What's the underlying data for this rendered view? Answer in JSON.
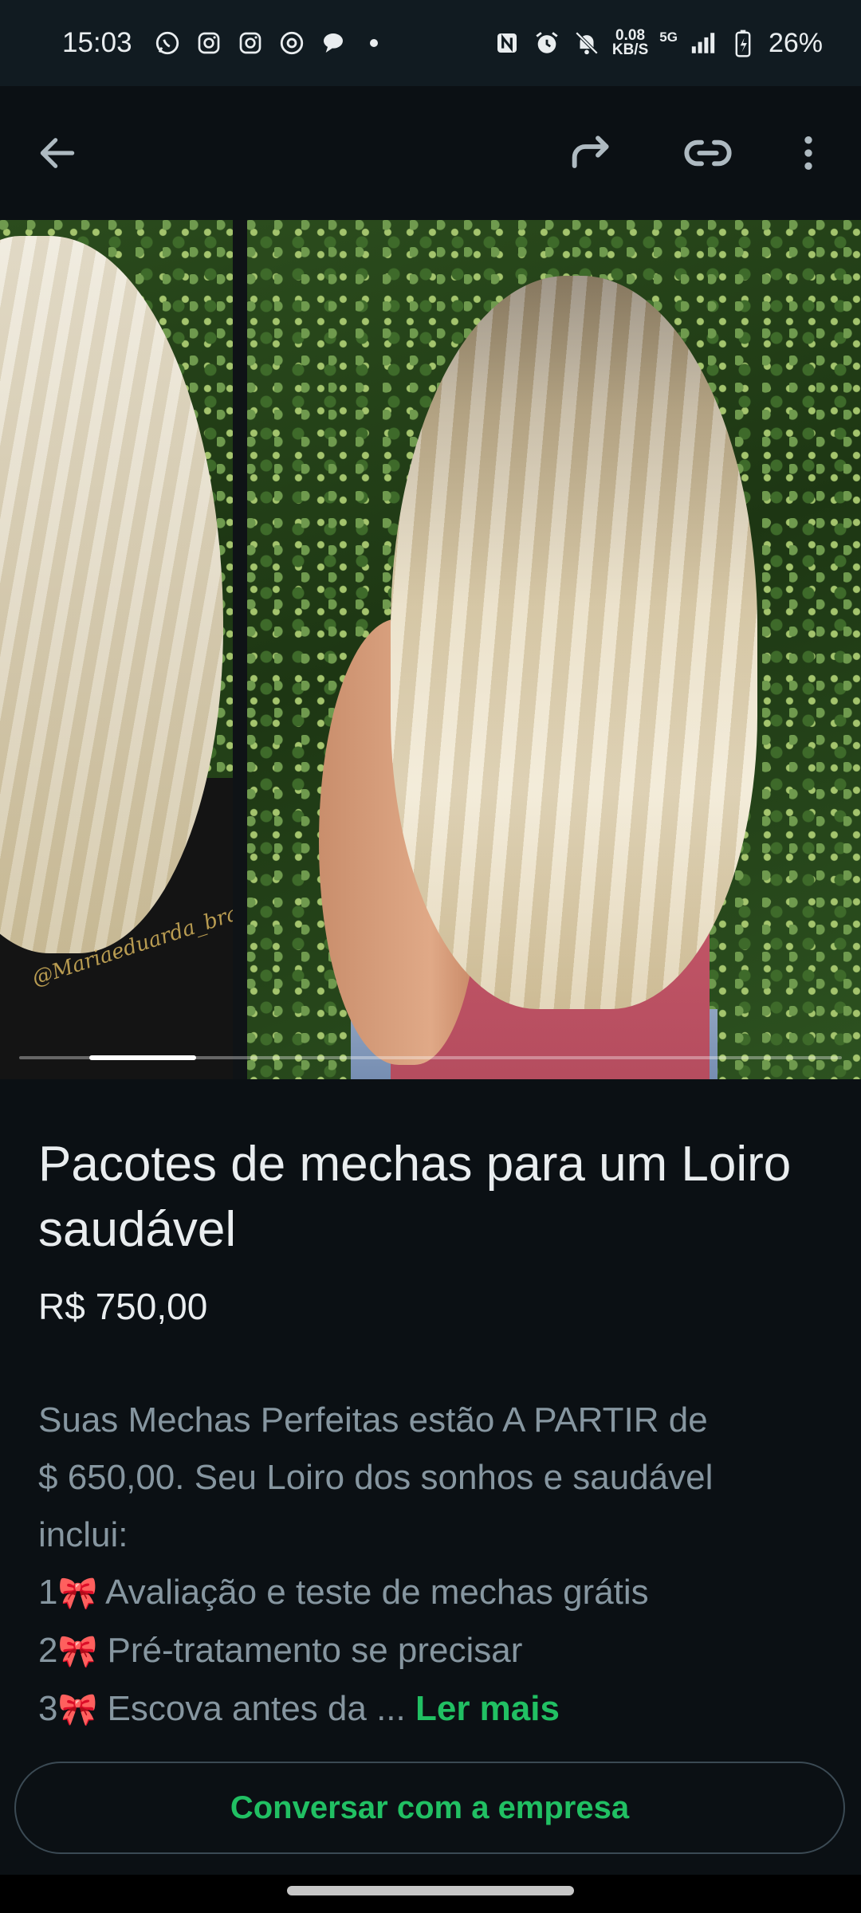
{
  "status_bar": {
    "time": "15:03",
    "notification_icons": [
      "whatsapp-icon",
      "instagram-icon",
      "instagram-icon",
      "threads-icon",
      "chat-bubble-icon"
    ],
    "network_speed_value": "0.08",
    "network_speed_unit": "KB/S",
    "network_type": "5G",
    "battery": "26%"
  },
  "app_bar": {
    "icons": [
      "back-arrow-icon",
      "share-forward-icon",
      "link-icon",
      "more-vert-icon"
    ]
  },
  "carousel": {
    "watermark": "@Mariaeduarda_braga",
    "active_index": 1,
    "total_images": 8
  },
  "product": {
    "title": "Pacotes de mechas para um Loiro saudável",
    "price": "R$ 750,00",
    "description": {
      "line1": "Suas Mechas Perfeitas estão A PARTIR de",
      "line2": "$ 650,00. Seu Loiro dos sonhos e saudável",
      "line3": "inclui:",
      "item1_num": "1",
      "item1_text": " Avaliação e teste de mechas grátis",
      "item2_num": "2",
      "item2_text": " Pré-tratamento se precisar",
      "item3_num": "3",
      "item3_text": " Escova antes da ... ",
      "bow": "🎀"
    },
    "read_more": "Ler mais"
  },
  "cta": {
    "label": "Conversar com a empresa"
  },
  "colors": {
    "background": "#0b1014",
    "accent_green": "#21c063",
    "muted_text": "#8696a0"
  }
}
